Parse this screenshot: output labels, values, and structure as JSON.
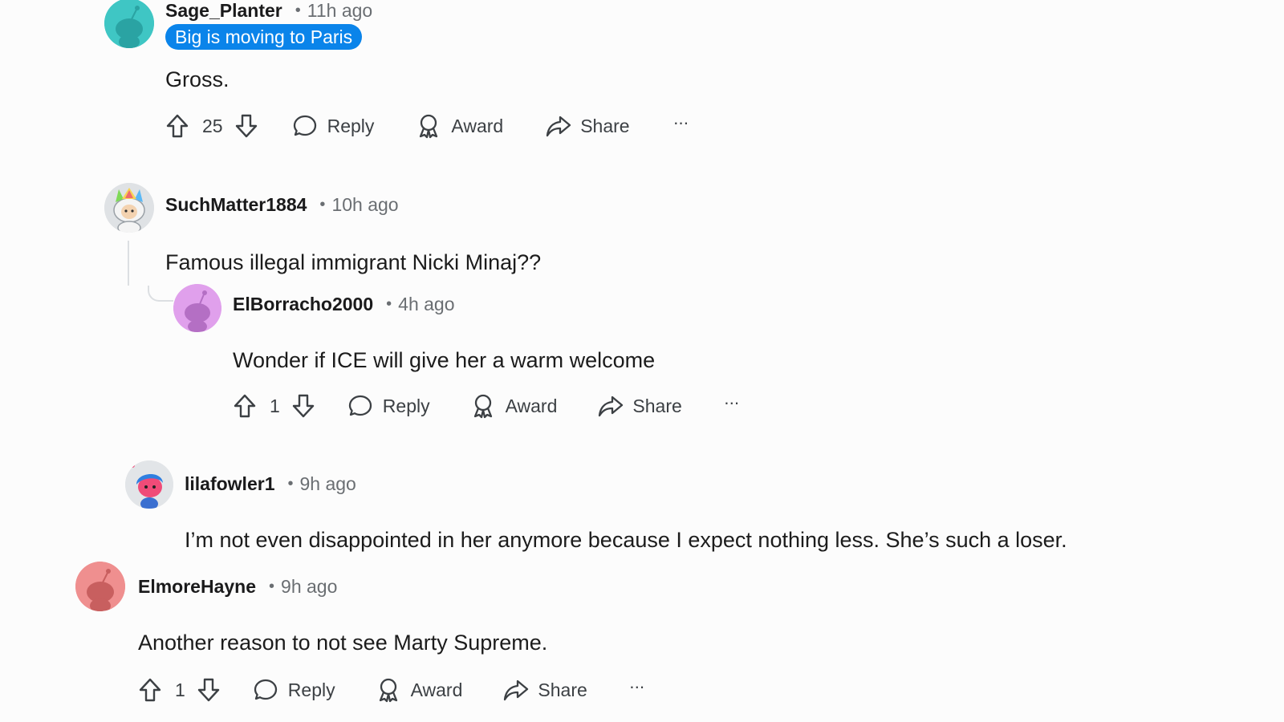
{
  "comments": [
    {
      "username": "Sage_Planter",
      "time": "11h ago",
      "flair": "Big is moving to Paris",
      "body": "Gross.",
      "votes": "25",
      "avatar_color": "#3fc6c4"
    },
    {
      "username": "SuchMatter1884",
      "time": "10h ago",
      "body": "Famous illegal immigrant Nicki Minaj??",
      "avatar_color": "#cfd3d6"
    },
    {
      "username": "ElBorracho2000",
      "time": "4h ago",
      "body": "Wonder if ICE will give her a warm welcome",
      "votes": "1",
      "avatar_color": "#e0a0ec"
    },
    {
      "username": "lilafowler1",
      "time": "9h ago",
      "body": "I’m not even disappointed in her anymore because I expect nothing less. She’s such a loser.",
      "avatar_color": "#e2e5e8"
    },
    {
      "username": "ElmoreHayne",
      "time": "9h ago",
      "body": "Another reason to not see Marty Supreme.",
      "votes": "1",
      "avatar_color": "#ef8f8f"
    }
  ],
  "actions": {
    "reply_label": "Reply",
    "award_label": "Award",
    "share_label": "Share",
    "more_label": "···"
  },
  "colors": {
    "flair_bg": "#0a84ea",
    "text": "#1c1c1c",
    "meta": "#6a6e72",
    "thread_line": "#dcdfe2"
  },
  "icons": [
    "upvote-icon",
    "downvote-icon",
    "reply-bubble-icon",
    "award-icon",
    "share-arrow-icon",
    "more-icon"
  ]
}
